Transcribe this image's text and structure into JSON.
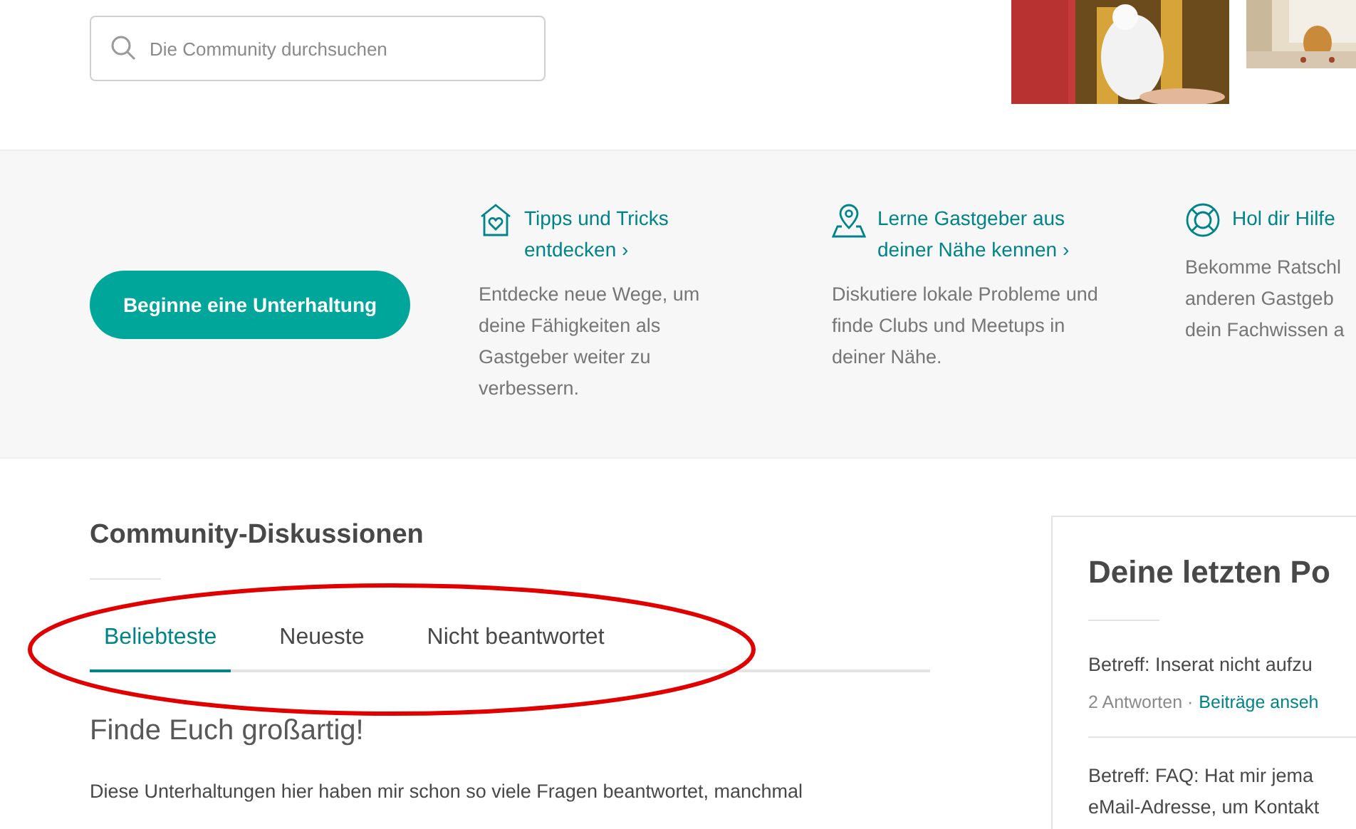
{
  "search": {
    "placeholder": "Die Community durchsuchen"
  },
  "start_button": {
    "label": "Beginne eine Unterhaltung"
  },
  "features": [
    {
      "kind": "house",
      "title": [
        "Tipps und Tricks",
        "entdecken ›"
      ],
      "description": [
        "Entdecke neue Wege, um",
        "deine Fähigkeiten als",
        "Gastgeber weiter zu",
        "verbessern."
      ]
    },
    {
      "kind": "pin",
      "title": [
        "Lerne Gastgeber aus",
        "deiner Nähe kennen ›"
      ],
      "description": [
        "Diskutiere lokale Probleme und",
        "finde Clubs und Meetups in",
        "deiner Nähe."
      ]
    },
    {
      "kind": "lifebuoy",
      "title": [
        "Hol dir Hilfe"
      ],
      "description": [
        "Bekomme Ratschl",
        "anderen Gastgeb",
        "dein Fachwissen a"
      ]
    }
  ],
  "discussions": {
    "heading": "Community-Diskussionen",
    "tabs": [
      {
        "label": "Beliebteste",
        "selected": true
      },
      {
        "label": "Neueste",
        "selected": false
      },
      {
        "label": "Nicht beantwortet",
        "selected": false
      }
    ],
    "post_title": "Finde Euch großartig!",
    "post_excerpt": "Diese Unterhaltungen hier haben mir schon so viele Fragen beantwortet, manchmal"
  },
  "annotation": {
    "kind": "ellipse"
  },
  "recent_posts": {
    "heading": "Deine letzten Po",
    "posts": [
      {
        "subject": [
          "Betreff: Inserat nicht aufzu"
        ],
        "replies": "2 Antworten ·",
        "link": "Beiträge anseh"
      },
      {
        "subject": [
          "Betreff: FAQ: Hat mir jema",
          "eMail-Adresse, um Kontakt"
        ]
      }
    ]
  }
}
